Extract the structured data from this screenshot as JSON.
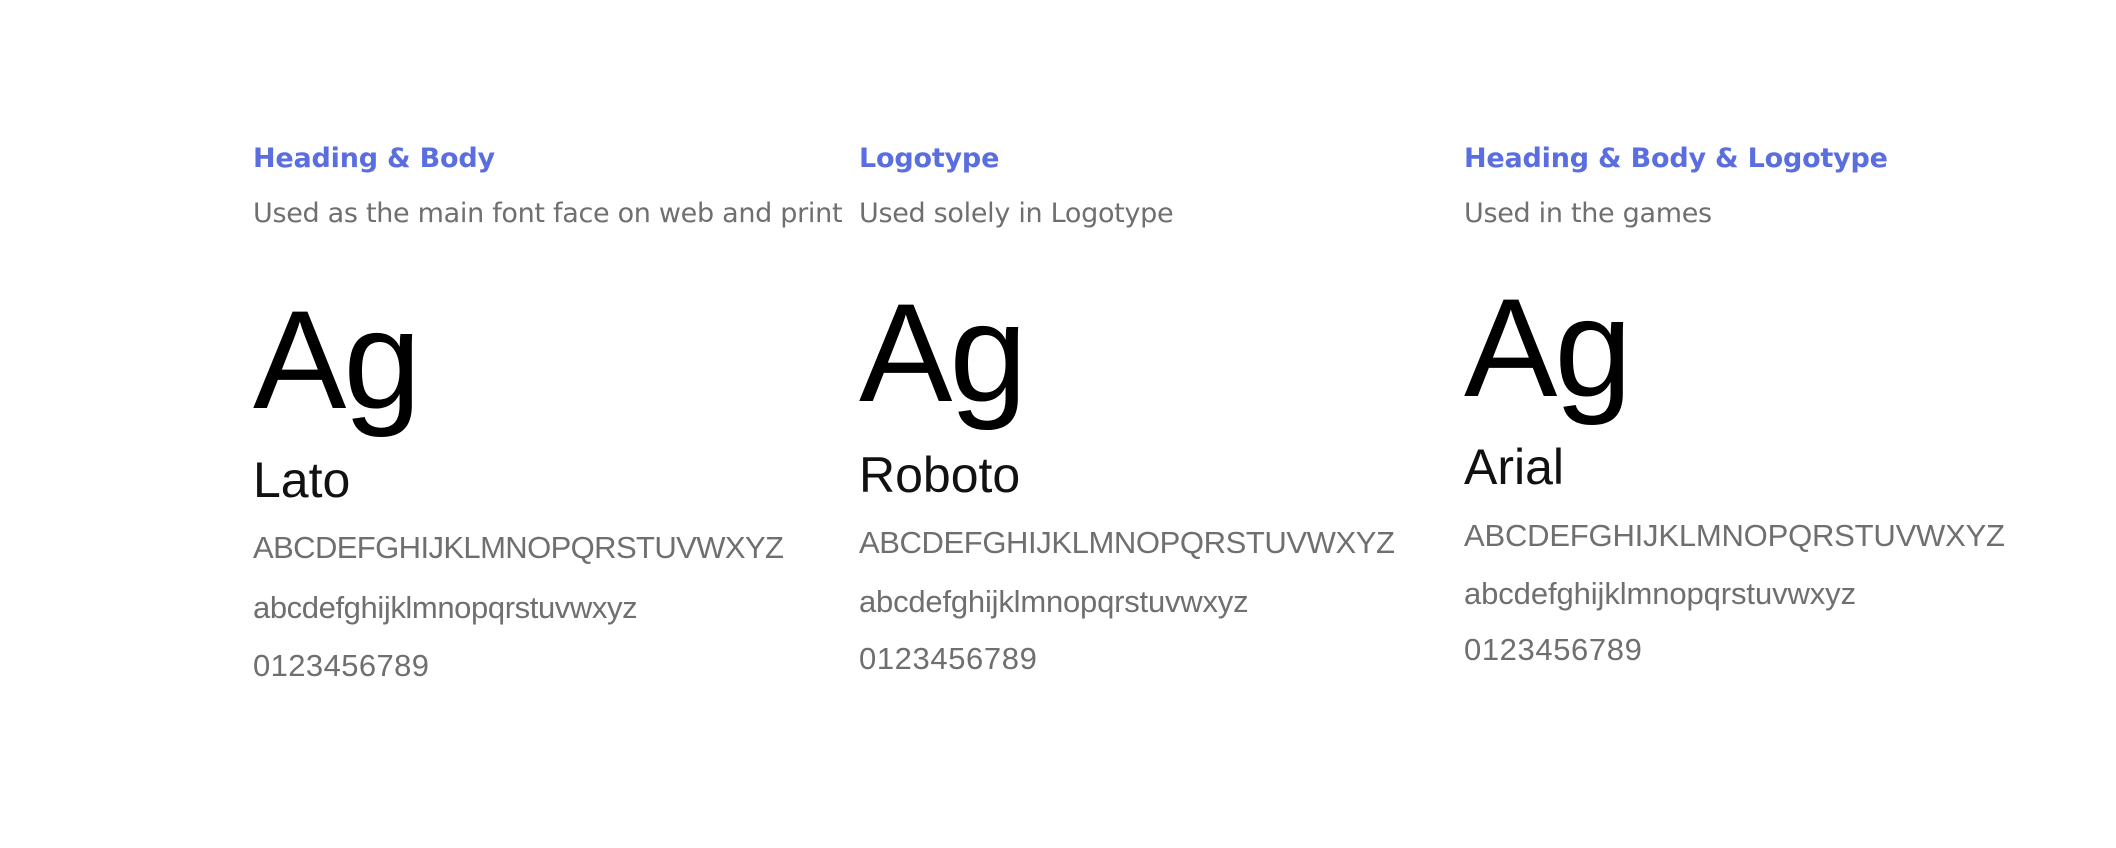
{
  "fonts": [
    {
      "category": "Heading & Body",
      "usage": "Used as the main font face on web and print",
      "sample": "Ag",
      "name": "Lato",
      "uppercase": "ABCDEFGHIJKLMNOPQRSTUVWXYZ",
      "lowercase": "abcdefghijklmnopqrstuvwxyz",
      "digits": "0123456789"
    },
    {
      "category": "Logotype",
      "usage": "Used solely in Logotype",
      "sample": "Ag",
      "name": "Roboto",
      "uppercase": "ABCDEFGHIJKLMNOPQRSTUVWXYZ",
      "lowercase": "abcdefghijklmnopqrstuvwxyz",
      "digits": "0123456789"
    },
    {
      "category": "Heading & Body & Logotype",
      "usage": "Used in the games",
      "sample": "Ag",
      "name": "Arial",
      "uppercase": "ABCDEFGHIJKLMNOPQRSTUVWXYZ",
      "lowercase": "abcdefghijklmnopqrstuvwxyz",
      "digits": "0123456789"
    }
  ],
  "colors": {
    "category": "#5a6ee0",
    "usage": "#6f6f6f",
    "sample": "#000000",
    "glyphs": "#6f6f6f"
  }
}
